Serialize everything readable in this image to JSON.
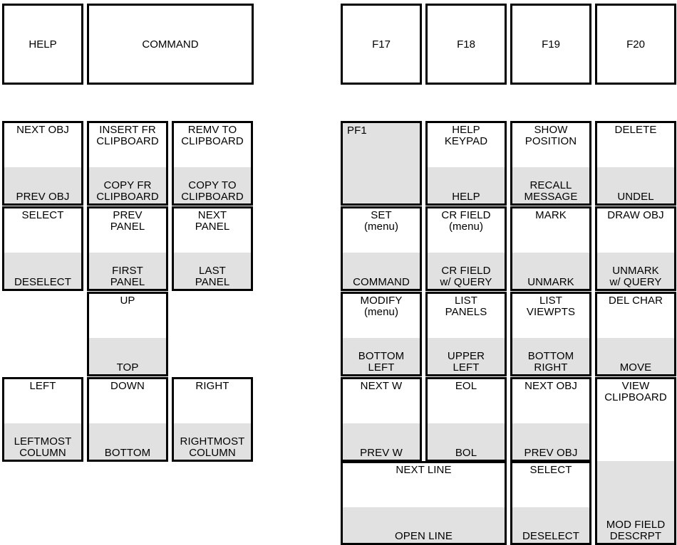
{
  "meta": {
    "diagram_title": "Keypad key assignment reference",
    "shade_color": "#e1e1e1",
    "border_color": "#000000",
    "background_color": "#ffffff"
  },
  "left_function_row": [
    {
      "name": "help",
      "label": "HELP"
    },
    {
      "name": "command",
      "label": "COMMAND"
    }
  ],
  "right_function_row": [
    {
      "name": "f17",
      "label": "F17"
    },
    {
      "name": "f18",
      "label": "F18"
    },
    {
      "name": "f19",
      "label": "F19"
    },
    {
      "name": "f20",
      "label": "F20"
    }
  ],
  "left_keypad": {
    "rows": [
      [
        {
          "name": "next-obj",
          "top": "NEXT OBJ",
          "bottom": "PREV OBJ"
        },
        {
          "name": "insert-fr-clipboard",
          "top": "INSERT FR\nCLIPBOARD",
          "bottom": "COPY FR\nCLIPBOARD"
        },
        {
          "name": "remv-to-clipboard",
          "top": "REMV TO\nCLIPBOARD",
          "bottom": "COPY TO\nCLIPBOARD"
        }
      ],
      [
        {
          "name": "select",
          "top": "SELECT",
          "bottom": "DESELECT"
        },
        {
          "name": "prev-panel",
          "top": "PREV\nPANEL",
          "bottom": "FIRST\nPANEL"
        },
        {
          "name": "next-panel",
          "top": "NEXT\nPANEL",
          "bottom": "LAST\nPANEL"
        }
      ],
      [
        {
          "name": "empty-left-1",
          "top": "",
          "bottom": "",
          "empty": true
        },
        {
          "name": "up",
          "top": "UP",
          "bottom": "TOP"
        },
        {
          "name": "empty-right-1",
          "top": "",
          "bottom": "",
          "empty": true
        }
      ],
      [
        {
          "name": "left",
          "top": "LEFT",
          "bottom": "LEFTMOST\nCOLUMN"
        },
        {
          "name": "down",
          "top": "DOWN",
          "bottom": "BOTTOM"
        },
        {
          "name": "right",
          "top": "RIGHT",
          "bottom": "RIGHTMOST\nCOLUMN"
        }
      ]
    ]
  },
  "right_keypad": {
    "rows": [
      [
        {
          "name": "pf1",
          "top": "PF1",
          "bottom": "",
          "style": "shaded-full"
        },
        {
          "name": "help-keypad",
          "top": "HELP\nKEYPAD",
          "bottom": "HELP"
        },
        {
          "name": "show-position",
          "top": "SHOW\nPOSITION",
          "bottom": "RECALL\nMESSAGE"
        },
        {
          "name": "delete",
          "top": "DELETE",
          "bottom": "UNDEL"
        }
      ],
      [
        {
          "name": "set-menu",
          "top": "SET\n(menu)",
          "bottom": "COMMAND"
        },
        {
          "name": "cr-field-menu",
          "top": "CR FIELD\n(menu)",
          "bottom": "CR FIELD\nw/ QUERY"
        },
        {
          "name": "mark",
          "top": "MARK",
          "bottom": "UNMARK"
        },
        {
          "name": "draw-obj",
          "top": "DRAW OBJ",
          "bottom": "UNMARK\nw/ QUERY"
        }
      ],
      [
        {
          "name": "modify-menu",
          "top": "MODIFY\n(menu)",
          "bottom": "BOTTOM\nLEFT"
        },
        {
          "name": "list-panels",
          "top": "LIST\nPANELS",
          "bottom": "UPPER\nLEFT"
        },
        {
          "name": "list-viewpts",
          "top": "LIST\nVIEWPTS",
          "bottom": "BOTTOM\nRIGHT"
        },
        {
          "name": "del-char",
          "top": "DEL CHAR",
          "bottom": "MOVE"
        }
      ],
      [
        {
          "name": "next-w",
          "top": "NEXT W",
          "bottom": "PREV W"
        },
        {
          "name": "eol",
          "top": "EOL",
          "bottom": "BOL"
        },
        {
          "name": "next-obj",
          "top": "NEXT OBJ",
          "bottom": "PREV OBJ"
        },
        {
          "name": "view-clipboard",
          "top": "VIEW\nCLIPBOARD",
          "bottom": "MOD FIELD\nDESCRPT",
          "span_rows": 2
        }
      ],
      [
        {
          "name": "next-line",
          "top": "NEXT LINE",
          "bottom": "OPEN LINE",
          "span_cols": 2
        },
        {
          "name": "select",
          "top": "SELECT",
          "bottom": "DESELECT"
        }
      ]
    ]
  }
}
